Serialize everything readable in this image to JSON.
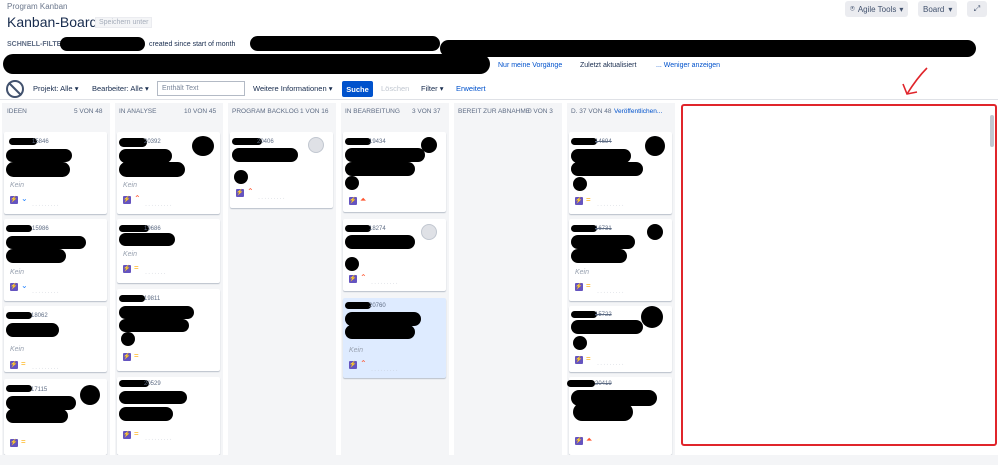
{
  "header": {
    "breadcrumb": "Program Kanban",
    "title": "Kanban-Board",
    "save_as": "Speichern unter",
    "agile_tools": "Agile Tools",
    "board": "Board"
  },
  "quickfilter": {
    "label": "SCHNELL-FILTER:",
    "items": [
      "created since start of month"
    ],
    "links": [
      "Nur meine Vorgänge",
      "Zuletzt aktualisiert",
      "... Weniger anzeigen"
    ]
  },
  "filters": {
    "projekt": "Projekt: Alle",
    "bearbeiter": "Bearbeiter: Alle",
    "search_placeholder": "Enthält Text",
    "weitere": "Weitere Informationen",
    "suche": "Suche",
    "loeschen": "Löschen",
    "filter": "Filter",
    "erweitert": "Erweitert"
  },
  "columns": [
    {
      "name": "IDEEN",
      "count": "5 VON 48"
    },
    {
      "name": "IN ANALYSE",
      "count": "10 VON 45"
    },
    {
      "name": "PROGRAM BACKLOG",
      "count": "1 VON 16"
    },
    {
      "name": "IN BEARBEITUNG",
      "count": "3 VON 37"
    },
    {
      "name": "BEREIT ZUR ABNAHME",
      "count": "0 VON 3"
    },
    {
      "name": "D. 37 VON 48",
      "count": "Veröffentlichen..."
    }
  ],
  "cards": {
    "c1_1_key": "15846",
    "c1_2_key": "15986",
    "c1_3_key": "18062",
    "c1_4_key": "17115",
    "c2_1_key": "20392",
    "c2_2_key": "19686",
    "c2_3_key": "19811",
    "c2_4_key": "20529",
    "c3_1_key": "20406",
    "c4_1_key": "19434",
    "c4_2_key": "18274",
    "c4_3_key": "20760",
    "c6_1_key": "14694",
    "c6_2_key": "16731",
    "c6_3_key": "15722",
    "c6_4_key": "20419",
    "kein": "Kein"
  },
  "colors": {
    "accent": "#0052cc",
    "story": "#6554c0",
    "annotation": "#e0252b"
  }
}
